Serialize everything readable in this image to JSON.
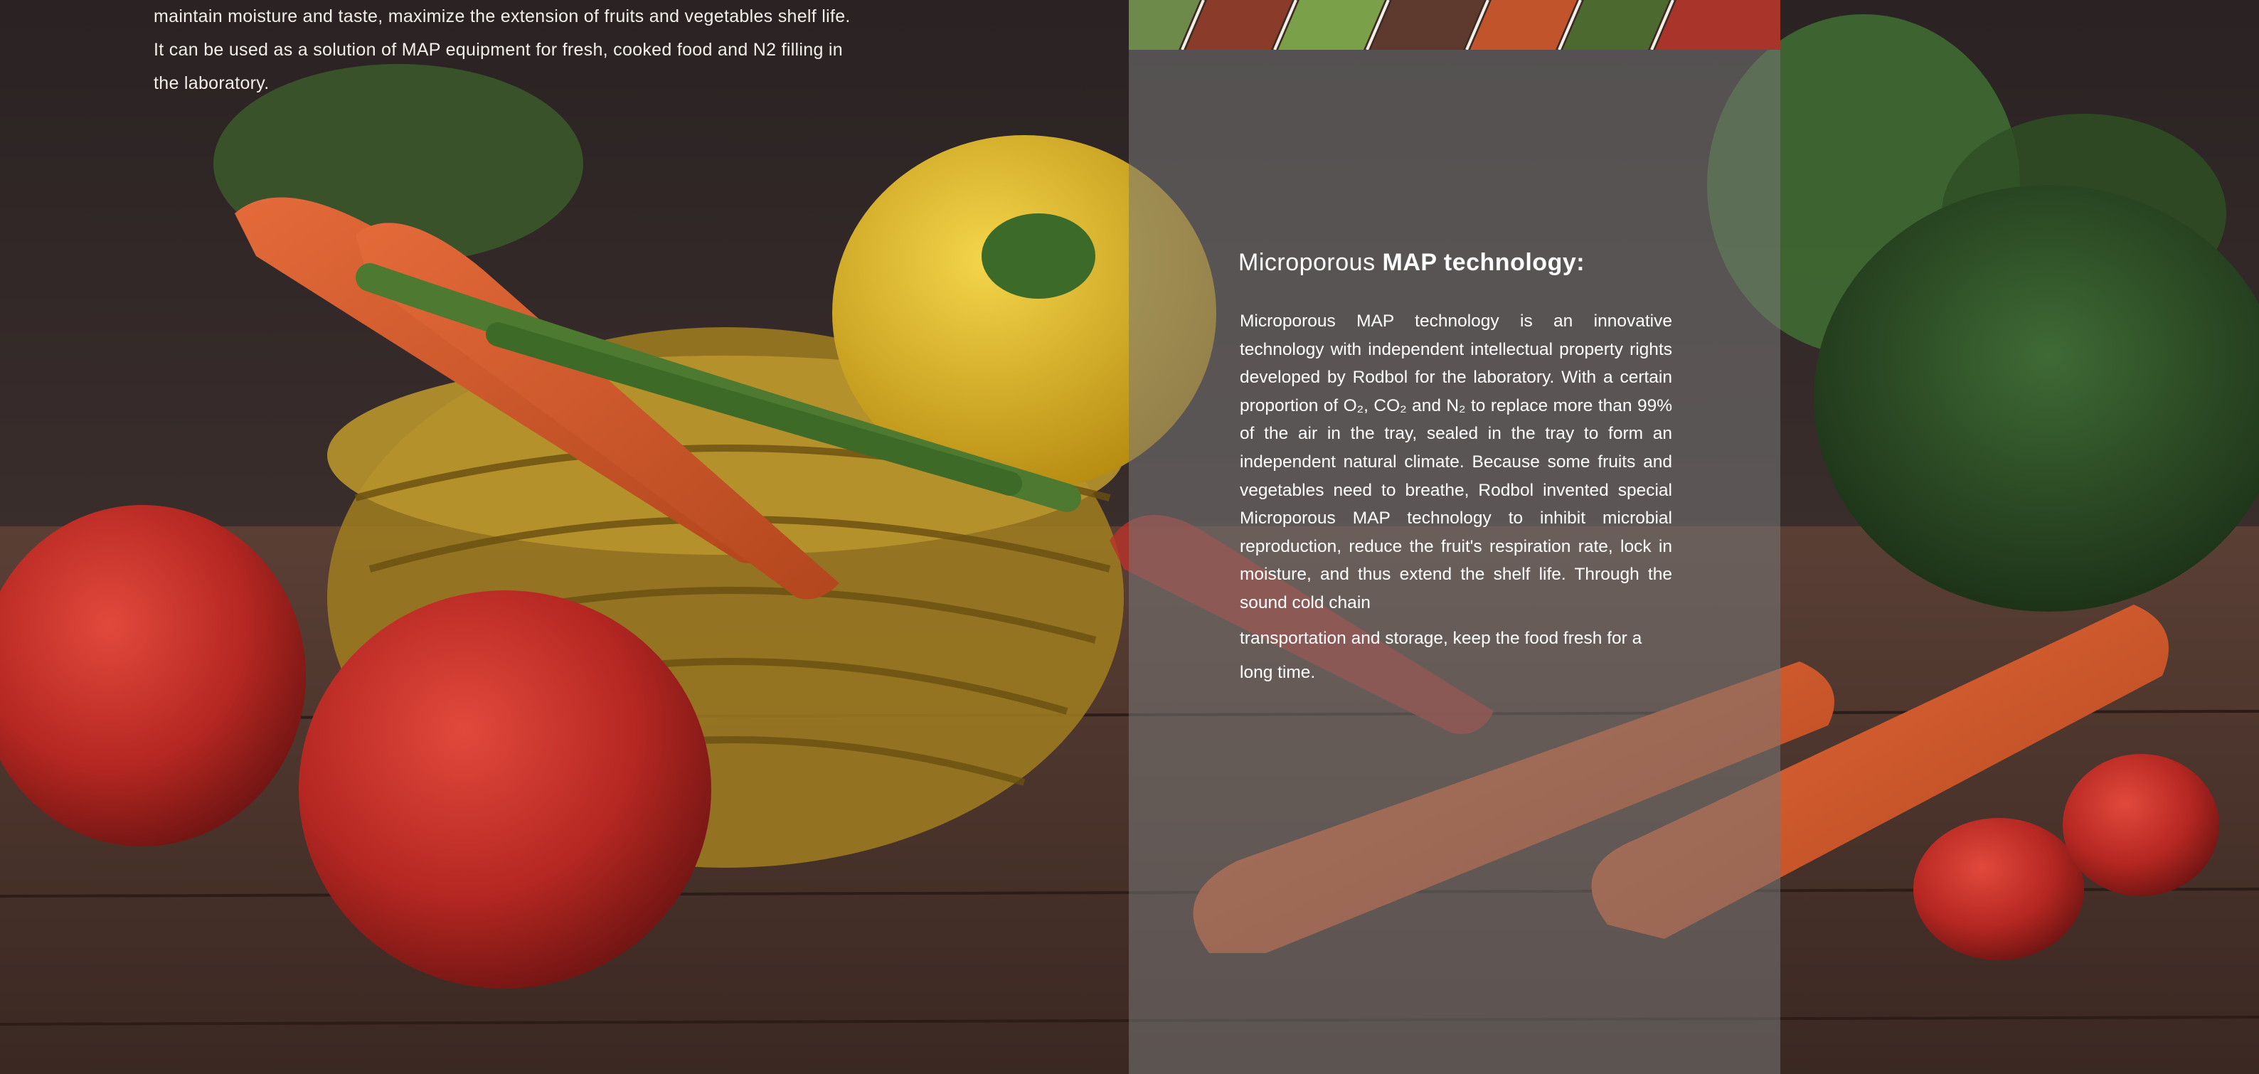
{
  "intro": {
    "line1": "maintain moisture and taste, maximize the extension of fruits and vegetables shelf life.",
    "line2": "It can be used as a solution of MAP equipment for fresh, cooked food and N2 filling in",
    "line3": "the laboratory."
  },
  "panel": {
    "title_light": "Microporous ",
    "title_bold": "MAP technology:",
    "body": "Microporous MAP technology is an innovative technology with independent intellectual property rights developed by Rodbol for the laboratory. With a certain proportion of O₂, CO₂ and N₂ to replace more than 99% of the air in the tray, sealed in the tray to form an independent natural climate. Because some fruits and vegetables need to breathe, Rodbol invented special Microporous MAP technology to inhibit microbial reproduction, reduce the fruit's respiration rate, lock in moisture, and thus extend the shelf life. Through the sound cold chain",
    "body_end": "transportation and storage, keep the food fresh for a long time."
  },
  "colors": {
    "background_dark": "#2b2424",
    "panel_overlay": "#787878",
    "text": "#ffffff"
  }
}
